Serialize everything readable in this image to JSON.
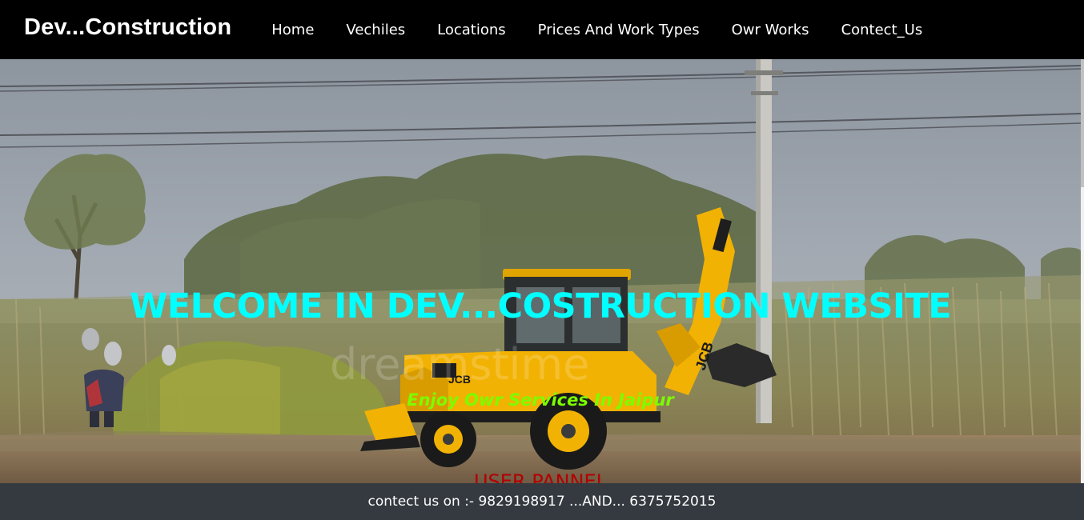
{
  "navbar": {
    "brand": "Dev...Construction",
    "items": [
      {
        "label": "Home"
      },
      {
        "label": "Vechiles"
      },
      {
        "label": "Locations"
      },
      {
        "label": "Prices And Work Types"
      },
      {
        "label": "Owr Works"
      },
      {
        "label": "Contect_Us"
      }
    ]
  },
  "hero": {
    "title": "WELCOME IN DEV...COSTRUCTION WEBSITE",
    "subtitle": "Enjoy Owr Services In Jaipur",
    "panel_heading": "USER PANNEL",
    "image_logo_text": "JCB",
    "colors": {
      "title": "#00ffff",
      "subtitle": "#7cfc00",
      "panel_heading": "#b30000"
    }
  },
  "footer": {
    "text": "contect us on :- 9829198917 ...AND... 6375752015"
  }
}
